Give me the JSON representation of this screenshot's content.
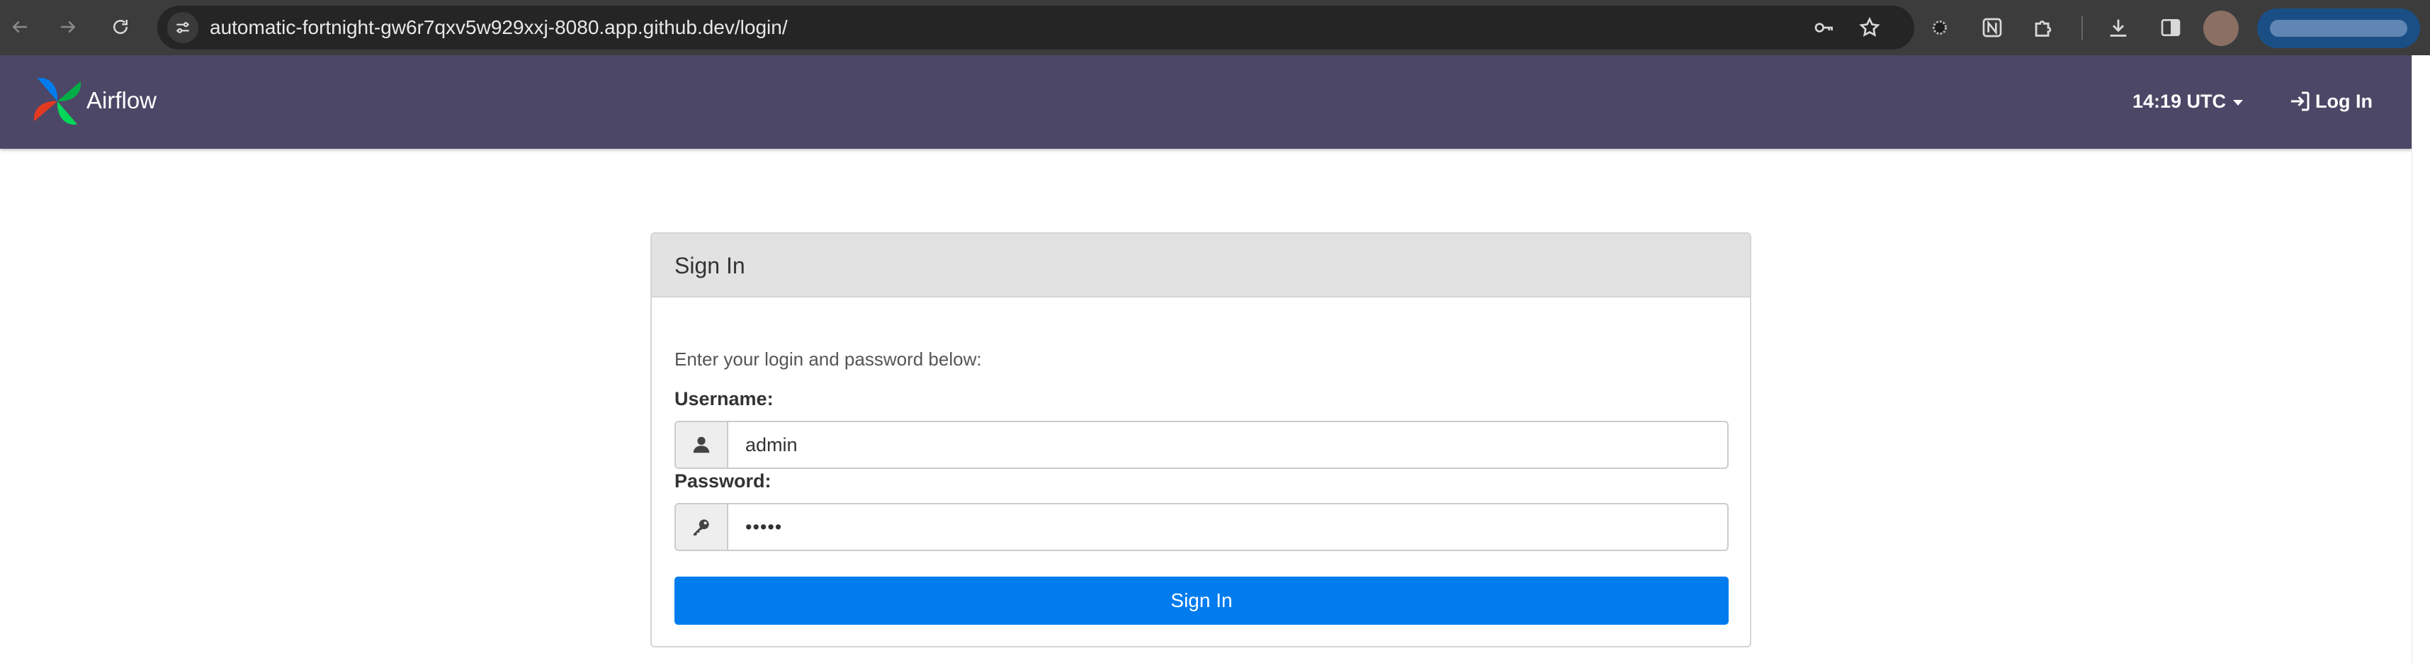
{
  "browser": {
    "url": "automatic-fortnight-gw6r7qxv5w929xxj-8080.app.github.dev/login/",
    "icons": [
      "back-icon",
      "forward-icon",
      "reload-icon",
      "site-info-icon",
      "password-key-icon",
      "bookmark-star-icon",
      "extension-icon",
      "notion-icon",
      "puzzle-icon",
      "download-icon",
      "side-panel-icon"
    ]
  },
  "navbar": {
    "brand": "Airflow",
    "clock": "14:19 UTC",
    "login": "Log In",
    "colors": {
      "background": "#4c4766"
    }
  },
  "login": {
    "title": "Sign In",
    "instructions": "Enter your login and password below:",
    "username_label": "Username:",
    "username_value": "admin",
    "password_label": "Password:",
    "password_value": "•••••",
    "submit_label": "Sign In",
    "colors": {
      "submit": "#017cee"
    }
  }
}
